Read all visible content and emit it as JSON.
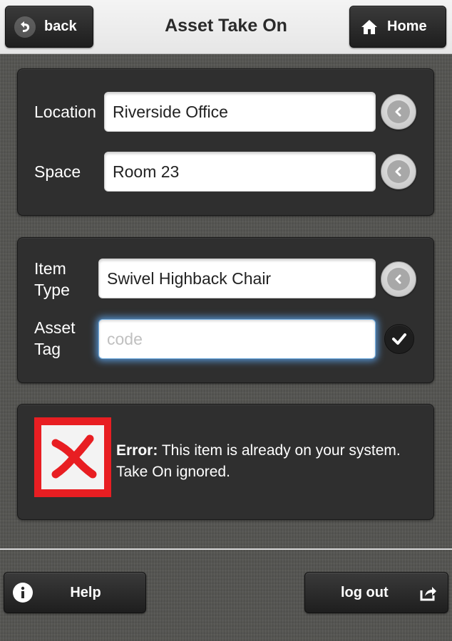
{
  "header": {
    "title": "Asset Take On",
    "back_label": "back",
    "home_label": "Home"
  },
  "location_panel": {
    "location_label": "Location",
    "location_value": "Riverside Office",
    "space_label": "Space",
    "space_value": "Room 23"
  },
  "item_panel": {
    "item_type_label_1": "Item",
    "item_type_label_2": "Type",
    "item_type_value": "Swivel Highback Chair",
    "asset_tag_label_1": "Asset",
    "asset_tag_label_2": "Tag",
    "asset_tag_value": "",
    "asset_tag_placeholder": "code"
  },
  "error": {
    "prefix": "Error:",
    "message": " This item is already on your system. Take On ignored."
  },
  "footer": {
    "help_label": "Help",
    "logout_label": "log out"
  },
  "colors": {
    "error_red": "#e81e22",
    "focus_glow": "#5aa0e6"
  }
}
